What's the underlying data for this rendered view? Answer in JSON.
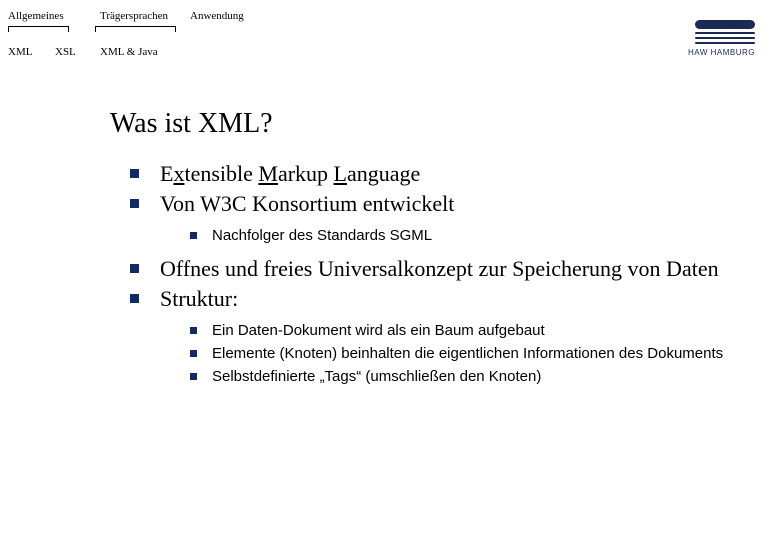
{
  "nav": {
    "row1": {
      "c1": "Allgemeines",
      "c2": "Trägersprachen",
      "c3": "Anwendung"
    },
    "row2": {
      "c1": "XML",
      "c2": "XSL",
      "c3": "XML & Java"
    }
  },
  "logo": {
    "caption": "HAW HAMBURG"
  },
  "title": "Was ist XML?",
  "bullets": {
    "b1_pre": "E",
    "b1_u1": "x",
    "b1_mid1": "tensible ",
    "b1_u2": "M",
    "b1_mid2": "arkup ",
    "b1_u3": "L",
    "b1_post": "anguage",
    "b2": "Von W3C Konsortium entwickelt",
    "b2_s1": "Nachfolger des Standards SGML",
    "b3": "Offnes und freies Universalkonzept zur Speicherung von Daten",
    "b4": "Struktur:",
    "b4_s1": "Ein Daten-Dokument wird als ein Baum aufgebaut",
    "b4_s2": "Elemente (Knoten) beinhalten die eigentlichen Informationen des Dokuments",
    "b4_s3": "Selbstdefinierte „Tags“ (umschließen den Knoten)"
  }
}
